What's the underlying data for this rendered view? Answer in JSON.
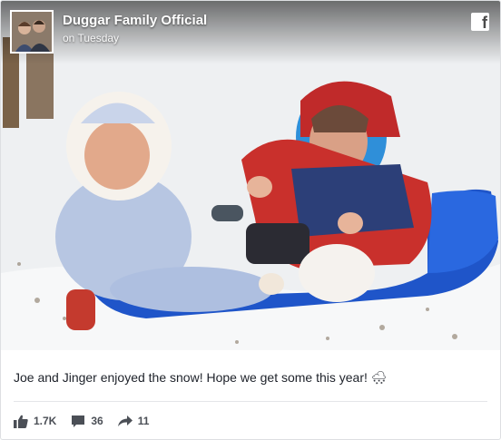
{
  "post": {
    "page_name": "Duggar Family Official",
    "time": "on Tuesday",
    "caption_text": "Joe and Jinger enjoyed the snow! Hope we get some this year!",
    "caption_emoji": "🌨"
  },
  "reactions": {
    "likes": "1.7K",
    "comments": "36",
    "shares": "11"
  },
  "icons": {
    "platform": "facebook-icon",
    "like": "thumbs-up-icon",
    "comment": "comment-bubble-icon",
    "share": "share-arrow-icon"
  },
  "colors": {
    "sled": "#1f55c9",
    "text": "#1d2129",
    "muted": "#4b4f56"
  }
}
